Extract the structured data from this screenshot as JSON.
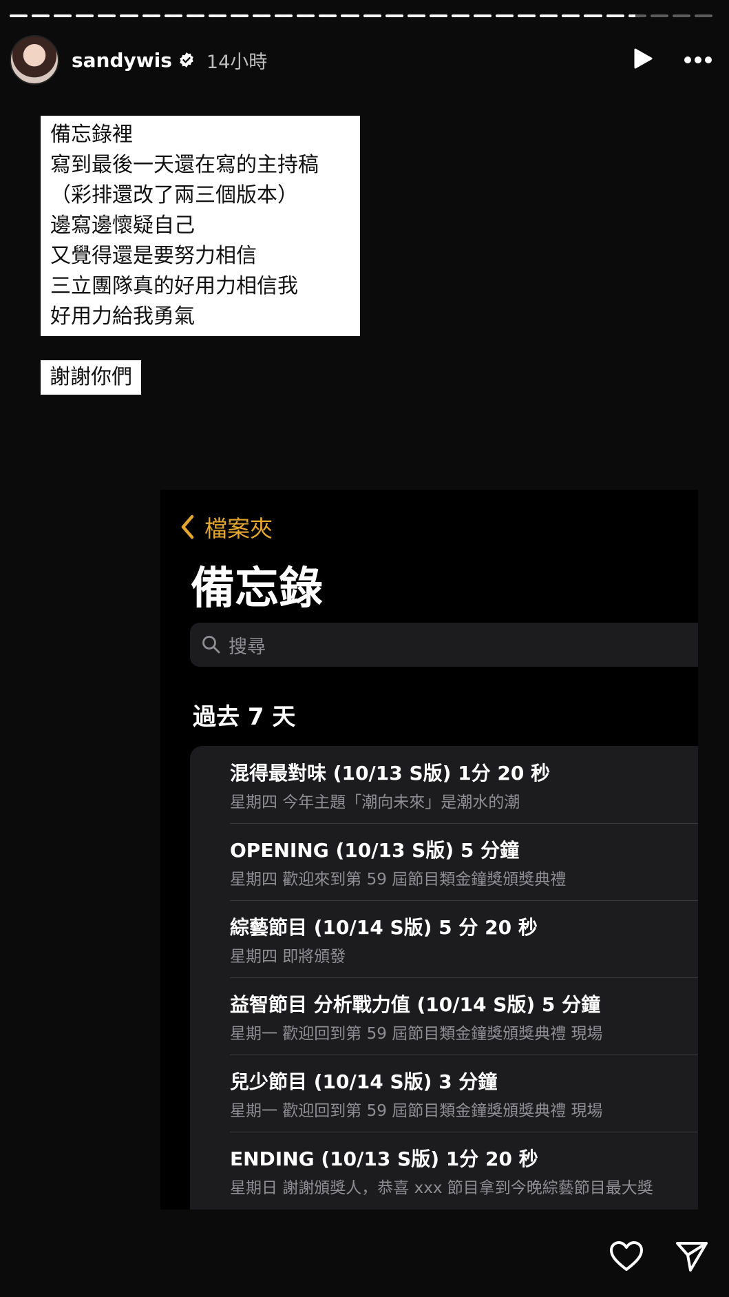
{
  "story": {
    "progress": [
      1,
      1,
      1,
      1,
      1,
      1,
      1,
      1,
      1,
      1,
      1,
      1,
      1,
      1,
      1,
      1,
      1,
      1,
      1,
      1,
      1,
      1,
      1,
      1,
      1,
      1,
      1,
      1,
      0.4,
      0,
      0,
      0
    ],
    "username": "sandywis",
    "time": "14小時",
    "icons": {
      "verified": "verified-badge-icon",
      "play": "play-icon",
      "more": "more-icon"
    }
  },
  "caption": {
    "lines": [
      "備忘錄裡",
      "寫到最後一天還在寫的主持稿",
      "（彩排還改了兩三個版本）",
      "邊寫邊懷疑自己",
      "又覺得還是要努力相信",
      "三立團隊真的好用力相信我",
      "好用力給我勇氣"
    ],
    "thanks": "謝謝你們"
  },
  "notes": {
    "back_label": "檔案夾",
    "title": "備忘錄",
    "search_placeholder": "搜尋",
    "section": "過去 7 天",
    "accent": "#e3a72f",
    "items": [
      {
        "title": "混得最對味 (10/13 S版) 1分 20 秒",
        "subtitle": "星期四  今年主題「潮向未來」是潮水的潮"
      },
      {
        "title": "OPENING (10/13 S版) 5 分鐘",
        "subtitle": "星期四  歡迎來到第 59 屆節目類金鐘獎頒獎典禮"
      },
      {
        "title": "綜藝節目 (10/14 S版) 5 分 20 秒",
        "subtitle": "星期四  即將頒發"
      },
      {
        "title": "益智節目 分析戰力值 (10/14 S版) 5 分鐘",
        "subtitle": "星期一  歡迎回到第 59 屆節目類金鐘獎頒獎典禮 現場"
      },
      {
        "title": "兒少節目 (10/14 S版) 3 分鐘",
        "subtitle": "星期一  歡迎回到第 59 屆節目類金鐘獎頒獎典禮 現場"
      },
      {
        "title": "ENDING (10/13 S版) 1分 20 秒",
        "subtitle": "星期日  謝謝頒獎人，恭喜 xxx 節目拿到今晚綜藝節目最大獎"
      }
    ]
  },
  "footer": {
    "icons": [
      "heart-icon",
      "send-icon"
    ]
  }
}
